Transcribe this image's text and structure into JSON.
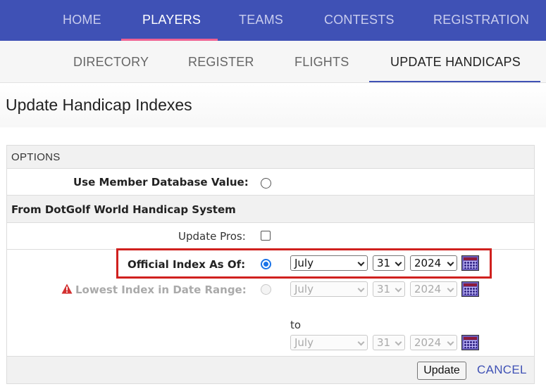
{
  "top_nav": {
    "items": [
      "HOME",
      "PLAYERS",
      "TEAMS",
      "CONTESTS",
      "REGISTRATION"
    ],
    "active": "PLAYERS",
    "background": "#3f51b5",
    "active_underline": "#f06292"
  },
  "sub_nav": {
    "items": [
      "DIRECTORY",
      "REGISTER",
      "FLIGHTS",
      "UPDATE HANDICAPS"
    ],
    "active": "UPDATE HANDICAPS"
  },
  "page": {
    "title": "Update Handicap Indexes"
  },
  "options": {
    "header": "OPTIONS",
    "member_db_label": "Use Member Database Value:",
    "section_label": "From DotGolf World Handicap System",
    "update_pros_label": "Update Pros:",
    "official_index_label": "Official Index As Of:",
    "official_date": {
      "month": "July",
      "day": "31",
      "year": "2024"
    },
    "lowest_index_label": "Lowest Index in Date Range:",
    "lowest_from": {
      "month": "July",
      "day": "31",
      "year": "2024"
    },
    "to_label": "to",
    "lowest_to": {
      "month": "July",
      "day": "31",
      "year": "2024"
    },
    "warning_icon": "warning-triangle-icon",
    "calendar_icon": "calendar-icon"
  },
  "actions": {
    "update_label": "Update",
    "cancel_label": "CANCEL"
  },
  "colors": {
    "accent": "#3f51b5",
    "highlight_box": "#d0201e",
    "radio_selected": "#1a73e8"
  }
}
